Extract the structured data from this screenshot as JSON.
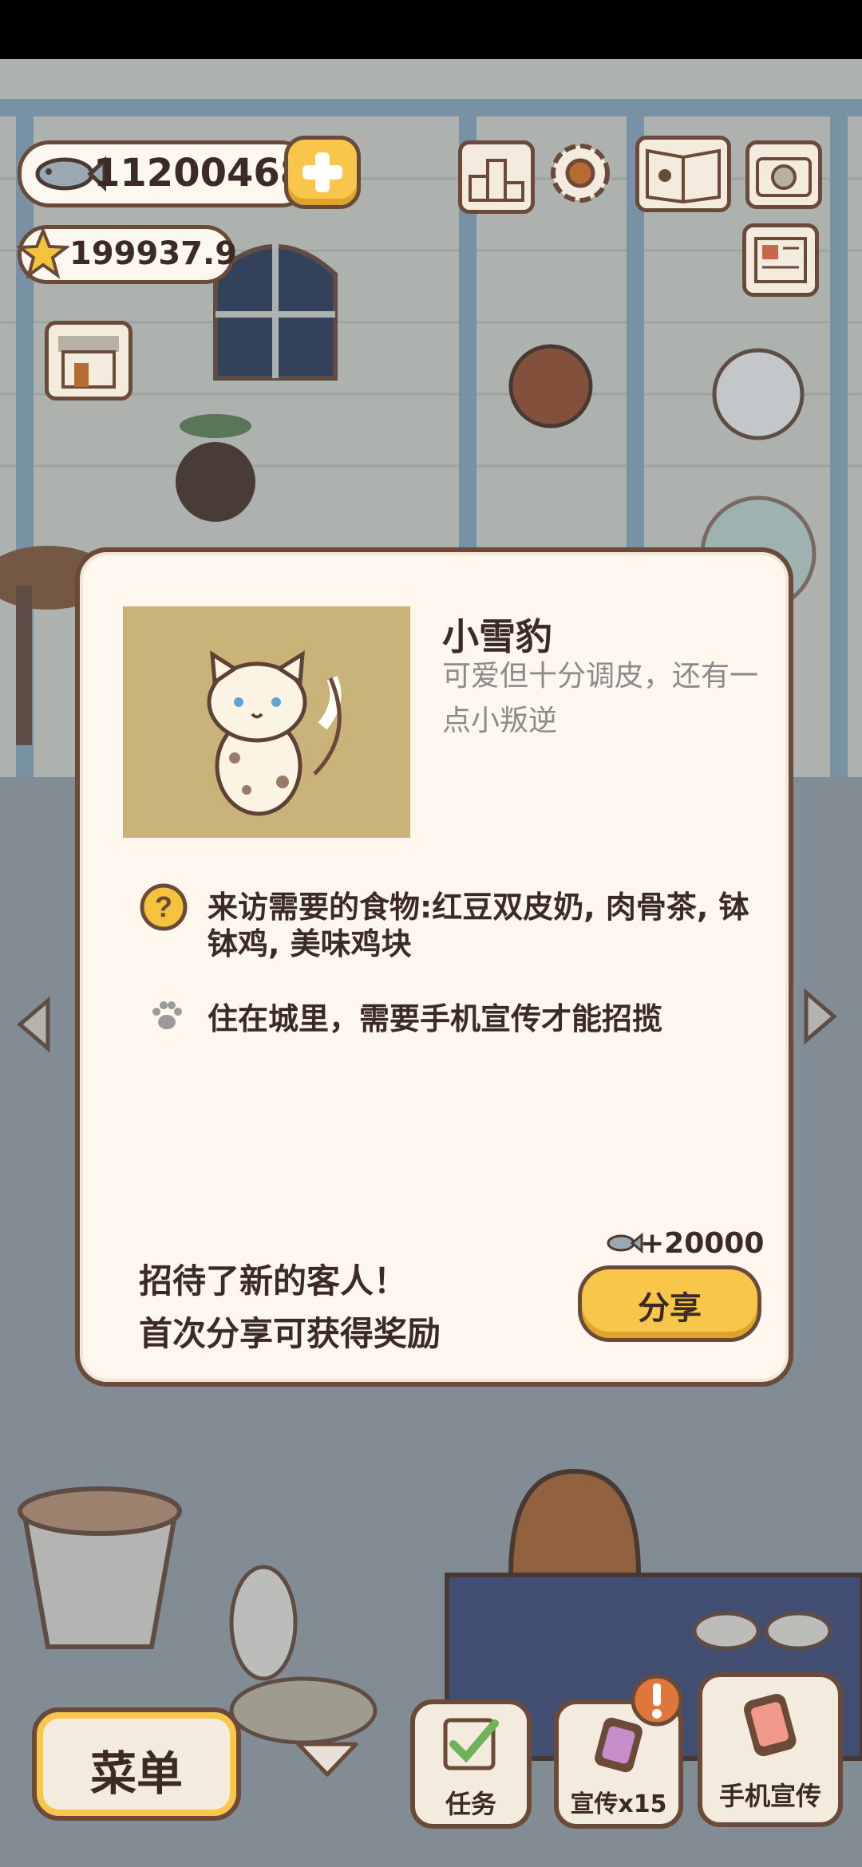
{
  "hud": {
    "fish_count": "11200468",
    "star_count": "199937.9"
  },
  "dialog": {
    "title": "小雪豹",
    "description": "可爱但十分调皮，还有一点小叛逆",
    "food_label": "来访需要的食物:红豆双皮奶, 肉骨茶, 钵钵鸡, 美味鸡块",
    "habitat_label": "住在城里，需要手机宣传才能招揽",
    "reward_label": "+20000",
    "message_line1": "招待了新的客人！",
    "message_line2": "首次分享可获得奖励",
    "share_button": "分享"
  },
  "bottom_bar": {
    "menu_button": "菜单",
    "tasks_button": "任务",
    "promo_button": "宣传x15",
    "phone_promo_button": "手机宣传"
  },
  "colors": {
    "outline": "#6b4a3a",
    "panel": "#fdf7ee",
    "accent_yellow": "#f7c64a",
    "portrait_bg": "#c9b378",
    "alert_orange": "#e0763a"
  }
}
